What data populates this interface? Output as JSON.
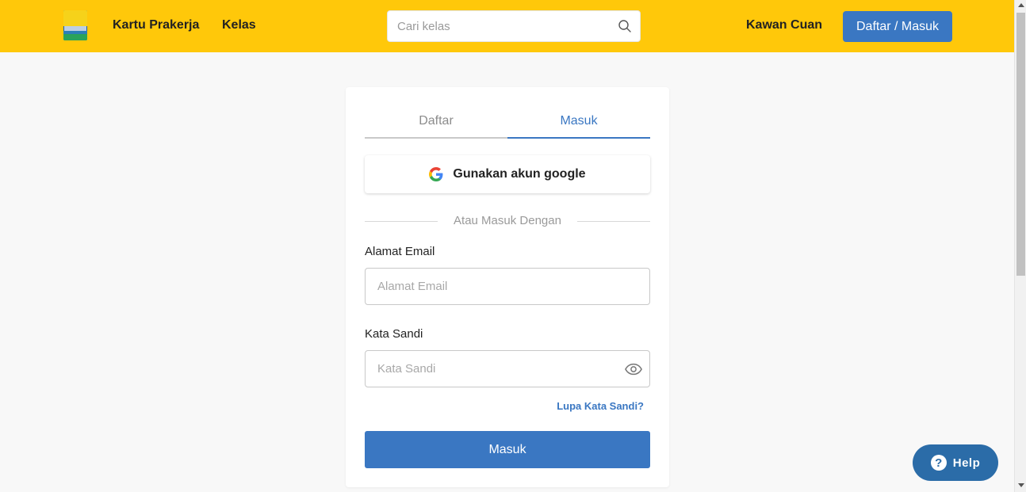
{
  "header": {
    "logo_icon": "siap-kerja-logo",
    "nav": {
      "kartu_prakerja": "Kartu Prakerja",
      "kelas": "Kelas",
      "kawan_cuan": "Kawan Cuan"
    },
    "search": {
      "placeholder": "Cari kelas",
      "icon": "search-icon"
    },
    "auth_button": "Daftar / Masuk",
    "background_color": "#ffc80a"
  },
  "auth_card": {
    "tabs": [
      {
        "label": "Daftar",
        "active": false
      },
      {
        "label": "Masuk",
        "active": true
      }
    ],
    "google_button": {
      "label": "Gunakan akun google",
      "icon": "google-icon"
    },
    "divider_text": "Atau Masuk Dengan",
    "email": {
      "label": "Alamat Email",
      "placeholder": "Alamat Email",
      "value": ""
    },
    "password": {
      "label": "Kata Sandi",
      "placeholder": "Kata Sandi",
      "value": "",
      "toggle_icon": "eye-icon"
    },
    "forgot_password": "Lupa Kata Sandi?",
    "submit_button": "Masuk",
    "accent_color": "#3a77c2"
  },
  "help_widget": {
    "label": "Help",
    "icon": "question-circle-icon",
    "color": "#2b6ca8"
  }
}
